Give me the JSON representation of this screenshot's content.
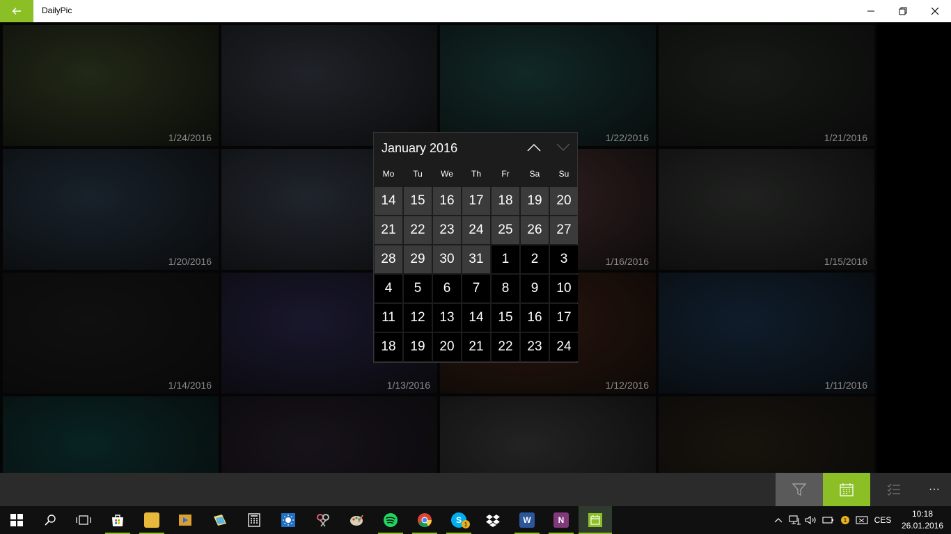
{
  "window": {
    "title": "DailyPic",
    "accent": "#8cbf26"
  },
  "tiles": [
    {
      "date": "1/24/2016",
      "color": "#3d4a2a"
    },
    {
      "date": "",
      "color": "#3a3f4a"
    },
    {
      "date": "1/22/2016",
      "color": "#1f4a48"
    },
    {
      "date": "1/21/2016",
      "color": "#2a302a"
    },
    {
      "date": "1/20/2016",
      "color": "#2c3d4d"
    },
    {
      "date": "",
      "color": "#3a4250"
    },
    {
      "date": "1/16/2016",
      "color": "#5a3a3a"
    },
    {
      "date": "1/15/2016",
      "color": "#3a3d3a"
    },
    {
      "date": "1/14/2016",
      "color": "#1e1e1e"
    },
    {
      "date": "1/13/2016",
      "color": "#2e2a50"
    },
    {
      "date": "1/12/2016",
      "color": "#4a2618"
    },
    {
      "date": "1/11/2016",
      "color": "#1c3550"
    },
    {
      "date": "",
      "color": "#104040"
    },
    {
      "date": "",
      "color": "#2a2230"
    },
    {
      "date": "",
      "color": "#404040"
    },
    {
      "date": "",
      "color": "#2a2418"
    }
  ],
  "calendar": {
    "month_label": "January 2016",
    "weekdays": [
      "Mo",
      "Tu",
      "We",
      "Th",
      "Fr",
      "Sa",
      "Su"
    ],
    "weeks": [
      [
        "14",
        "15",
        "16",
        "17",
        "18",
        "19",
        "20"
      ],
      [
        "21",
        "22",
        "23",
        "24",
        "25",
        "26",
        "27"
      ],
      [
        "28",
        "29",
        "30",
        "31",
        "1",
        "2",
        "3"
      ],
      [
        "4",
        "5",
        "6",
        "7",
        "8",
        "9",
        "10"
      ],
      [
        "11",
        "12",
        "13",
        "14",
        "15",
        "16",
        "17"
      ],
      [
        "18",
        "19",
        "20",
        "21",
        "22",
        "23",
        "24"
      ]
    ],
    "prev_month_cells": 18
  },
  "appbar": {
    "more_label": "···"
  },
  "taskbar": {
    "language": "CES",
    "time": "10:18",
    "date": "26.01.2016",
    "notification_count": "1",
    "skype_badge": "1"
  }
}
